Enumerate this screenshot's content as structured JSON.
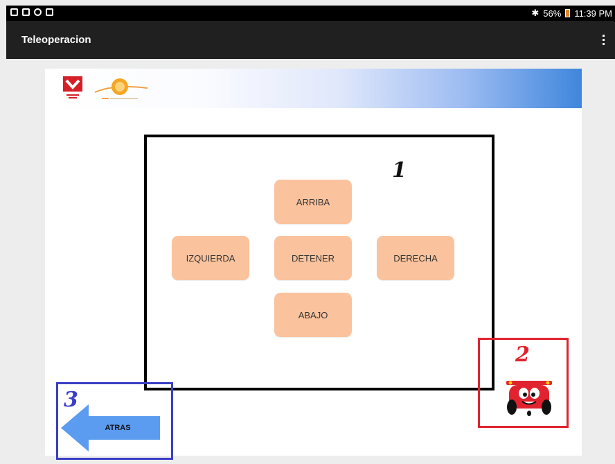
{
  "status_bar": {
    "battery": "56%",
    "time": "11:39 PM",
    "icons": [
      "gallery-icon",
      "screenshot-icon",
      "sync-icon",
      "briefcase-icon",
      "bluetooth-icon",
      "battery-icon"
    ]
  },
  "app_bar": {
    "title": "Teleoperacion",
    "menu_icon": "overflow-menu-icon"
  },
  "markers": {
    "one": "1",
    "two": "2",
    "three": "3"
  },
  "controls": {
    "up": "ARRIBA",
    "left": "IZQUIERDA",
    "stop": "DETENER",
    "right": "DERECHA",
    "down": "ABAJO"
  },
  "back": {
    "label": "ATRAS"
  },
  "colors": {
    "button": "#fbc39d",
    "box_1": "#000000",
    "box_2": "#e0232e",
    "box_3": "#3a3ec6",
    "arrow": "#5b9bf0",
    "banner_end": "#3f86dc"
  }
}
